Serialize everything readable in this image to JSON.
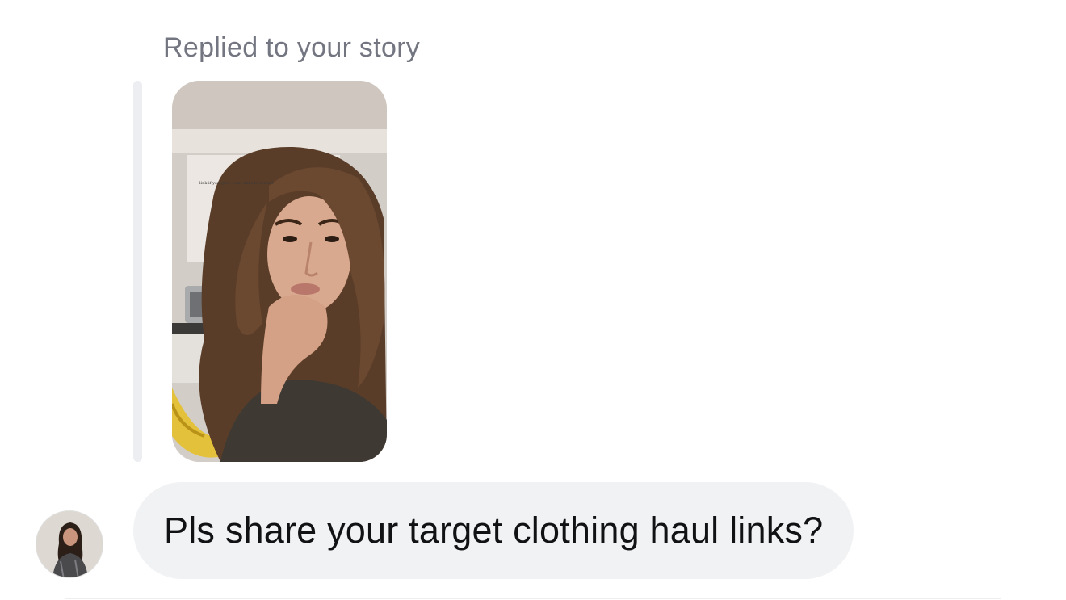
{
  "reply": {
    "caption": "Replied to your story"
  },
  "story": {
    "overlay_text": "link if you guys want links to thread"
  },
  "message": {
    "text": "Pls share your target clothing haul links?"
  },
  "colors": {
    "caption_gray": "#737680",
    "bubble_background": "#f1f2f4",
    "quote_bar": "#eceef1",
    "text_dark": "#111214"
  },
  "icons": {
    "avatar": "user-avatar-photo",
    "story": "story-thumbnail-photo"
  }
}
